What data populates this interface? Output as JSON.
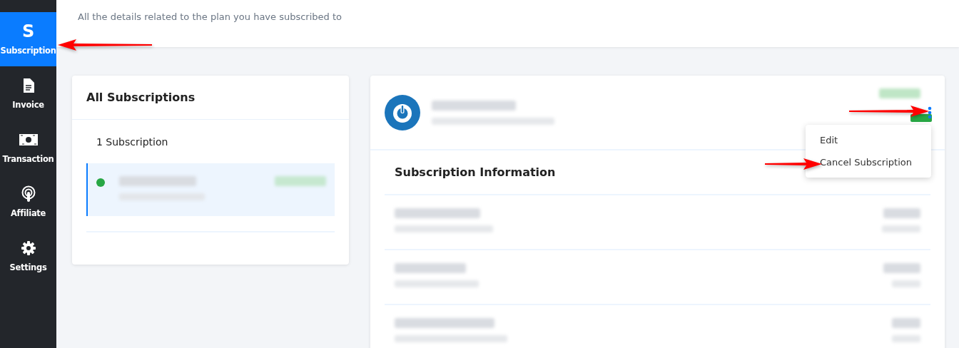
{
  "sidebar": {
    "items": [
      {
        "kind": "letter",
        "icon_text": "S",
        "label": "Subscription",
        "selected": true
      },
      {
        "kind": "document",
        "label": "Invoice",
        "selected": false
      },
      {
        "kind": "banknote",
        "label": "Transaction",
        "selected": false
      },
      {
        "kind": "podcast",
        "label": "Affiliate",
        "selected": false
      },
      {
        "kind": "gear",
        "label": "Settings",
        "selected": false
      }
    ]
  },
  "header": {
    "subtitle": "All the details related to the plan you have subscribed to"
  },
  "subscriptions_panel": {
    "title": "All Subscriptions",
    "count": "1 Subscription",
    "items": [
      {
        "selected": true,
        "color": "#28a745"
      }
    ]
  },
  "detail_panel": {
    "menu": {
      "open": true,
      "items": [
        "Edit",
        "Cancel Subscription"
      ]
    },
    "section_title": "Subscription Information"
  }
}
